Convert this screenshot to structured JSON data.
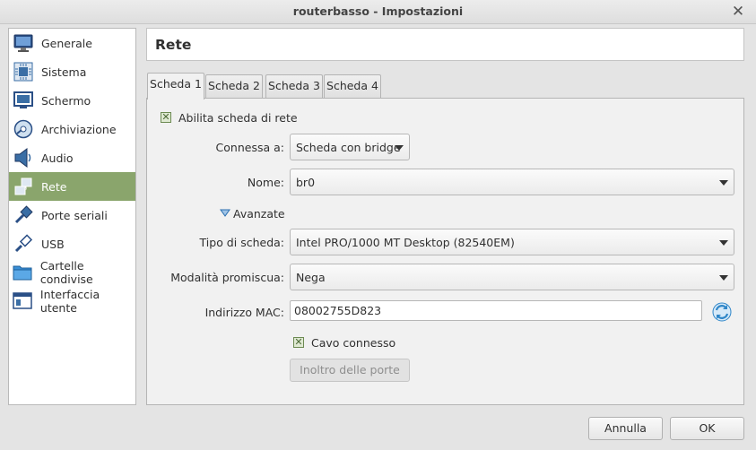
{
  "window": {
    "title": "routerbasso - Impostazioni"
  },
  "sidebar": {
    "items": [
      {
        "label": "Generale",
        "icon": "monitor-icon"
      },
      {
        "label": "Sistema",
        "icon": "chip-icon"
      },
      {
        "label": "Schermo",
        "icon": "display-icon"
      },
      {
        "label": "Archiviazione",
        "icon": "disk-icon"
      },
      {
        "label": "Audio",
        "icon": "speaker-icon"
      },
      {
        "label": "Rete",
        "icon": "network-icon",
        "selected": true
      },
      {
        "label": "Porte seriali",
        "icon": "serial-port-icon"
      },
      {
        "label": "USB",
        "icon": "usb-icon"
      },
      {
        "label": "Cartelle condivise",
        "icon": "folder-icon"
      },
      {
        "label": "Interfaccia utente",
        "icon": "window-icon"
      }
    ]
  },
  "header": {
    "title": "Rete"
  },
  "tabs": [
    "Scheda 1",
    "Scheda 2",
    "Scheda 3",
    "Scheda 4"
  ],
  "form": {
    "enable_adapter": {
      "label": "Abilita scheda di rete",
      "checked": true
    },
    "attached_to": {
      "label": "Connessa a:",
      "value": "Scheda con bridge"
    },
    "name": {
      "label": "Nome:",
      "value": "br0"
    },
    "advanced": {
      "label": "Avanzate"
    },
    "adapter_type": {
      "label": "Tipo di scheda:",
      "value": "Intel PRO/1000 MT Desktop (82540EM)"
    },
    "promiscuous": {
      "label": "Modalità promiscua:",
      "value": "Nega"
    },
    "mac": {
      "label": "Indirizzo MAC:",
      "value": "08002755D823"
    },
    "cable": {
      "label": "Cavo connesso",
      "checked": true
    },
    "port_forward": {
      "label": "Inoltro delle porte"
    }
  },
  "buttons": {
    "cancel": "Annulla",
    "ok": "OK"
  },
  "colors": {
    "accent": "#8aa56c",
    "check": "#4c6a36",
    "refresh": "#2f86c8"
  }
}
